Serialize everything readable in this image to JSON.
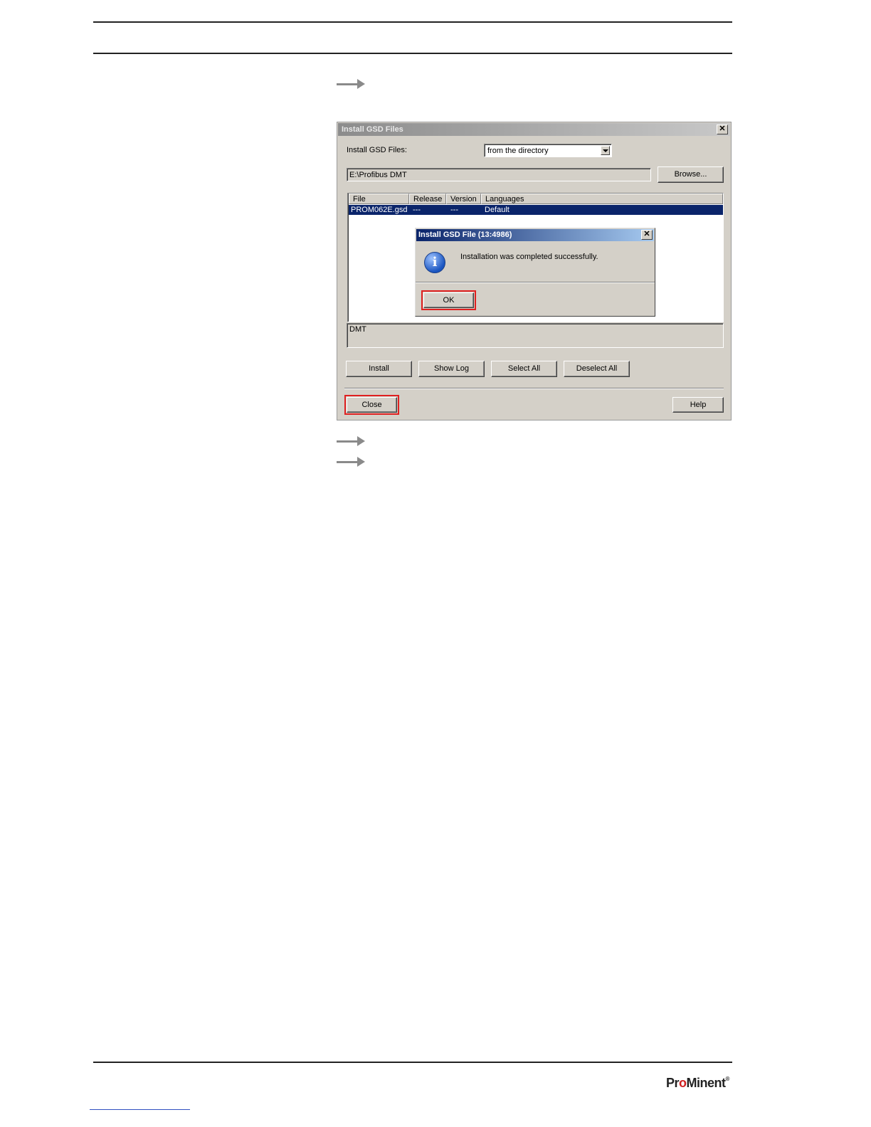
{
  "dialog": {
    "title": "Install GSD Files",
    "install_label": "Install GSD Files:",
    "source_select": "from the directory",
    "path": "E:\\Profibus DMT",
    "browse_label": "Browse...",
    "columns": [
      "File",
      "Release",
      "Version",
      "Languages"
    ],
    "rows": [
      {
        "file": "PROM062E.gsd",
        "release": "---",
        "version": "---",
        "languages": "Default"
      }
    ],
    "description": "DMT",
    "buttons": {
      "install": "Install",
      "show_log": "Show Log",
      "select_all": "Select All",
      "deselect_all": "Deselect All",
      "close": "Close",
      "help": "Help"
    },
    "close_glyph": "✕"
  },
  "message_box": {
    "title": "Install GSD File (13:4986)",
    "text": "Installation was completed successfully.",
    "ok_label": "OK",
    "icon_glyph": "i",
    "close_glyph": "✕"
  },
  "footer": {
    "logo_pre": "Pr",
    "logo_o": "o",
    "logo_post": "Minent",
    "logo_reg": "®"
  },
  "colors": {
    "highlight": "#e02020",
    "selection": "#0a246a",
    "dialog_bg": "#d4d0c8"
  }
}
